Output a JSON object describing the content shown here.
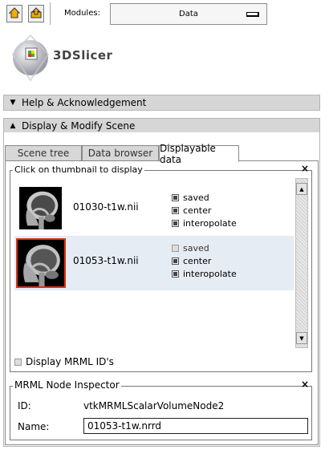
{
  "toolbar": {
    "home_icon": "home-icon",
    "save_icon": "save-icon",
    "modules_label": "Modules:",
    "modules_selected": "Data"
  },
  "logo": {
    "text": "3DSlicer"
  },
  "panels": {
    "help": "Help & Acknowledgement",
    "display": "Display & Modify Scene"
  },
  "tabs": [
    {
      "label": "Scene tree",
      "active": false
    },
    {
      "label": "Data browser",
      "active": false
    },
    {
      "label": "Displayable data",
      "active": true
    }
  ],
  "thumb_group": {
    "title": "Click on thumbnail to display",
    "close": "×",
    "items": [
      {
        "name": "01030-t1w.nii",
        "selected": false,
        "options": [
          {
            "label": "saved",
            "checked": true
          },
          {
            "label": "center",
            "checked": true
          },
          {
            "label": "interopolate",
            "checked": true
          }
        ]
      },
      {
        "name": "01053-t1w.nii",
        "selected": true,
        "options": [
          {
            "label": "saved",
            "checked": false
          },
          {
            "label": "center",
            "checked": true
          },
          {
            "label": "interopolate",
            "checked": true
          }
        ]
      }
    ],
    "display_ids_label": "Display MRML ID's",
    "display_ids_checked": false
  },
  "inspector": {
    "title": "MRML Node Inspector",
    "close": "×",
    "id_label": "ID:",
    "id_value": "vtkMRMLScalarVolumeNode2",
    "name_label": "Name:",
    "name_value": "01053-t1w.nrrd"
  },
  "colors": {
    "selected_row": "#e6ecf4",
    "selected_thumb_border": "#dd3311",
    "panel_header": "#d6d6d6"
  }
}
